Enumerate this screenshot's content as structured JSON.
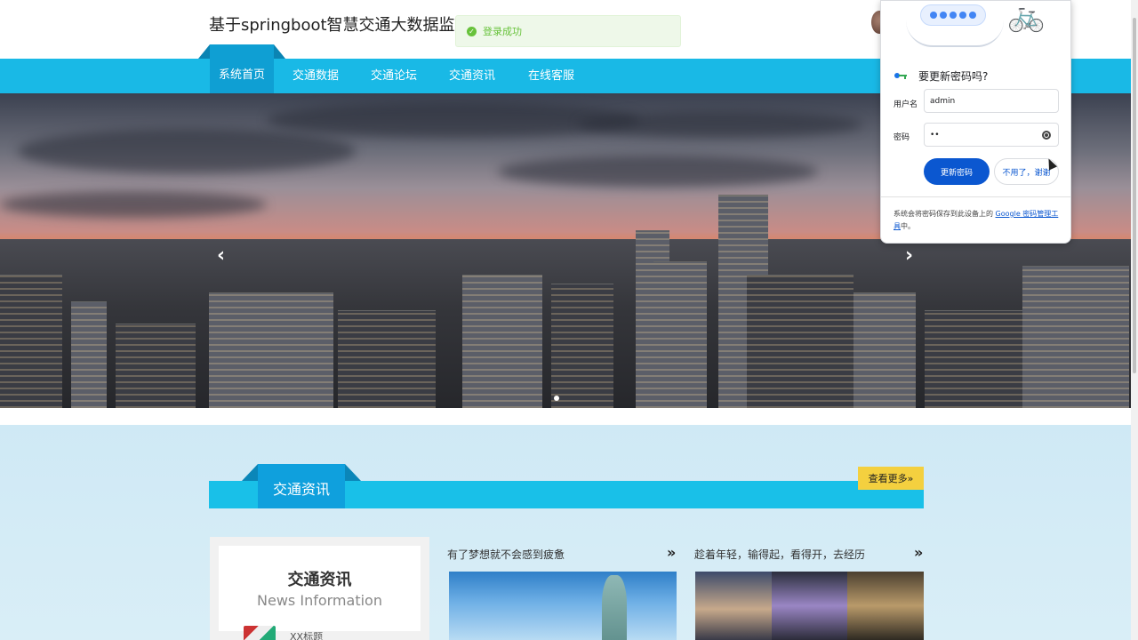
{
  "header": {
    "site_title": "基于springboot智慧交通大数据监控平",
    "toast": "登录成功"
  },
  "nav": {
    "items": [
      "系统首页",
      "交通数据",
      "交通论坛",
      "交通资讯",
      "在线客服"
    ]
  },
  "banner": {
    "prev_icon": "chevron-left-icon",
    "next_icon": "chevron-right-icon"
  },
  "section": {
    "title": "交通资讯",
    "more_label": "查看更多»"
  },
  "news_card": {
    "title": "交通资讯",
    "subtitle": "News Information",
    "item": "XX标题"
  },
  "columns": [
    {
      "title": "有了梦想就不会感到疲惫",
      "arrow": "»"
    },
    {
      "title": "趁着年轻，输得起，看得开，去经历",
      "arrow": "»"
    }
  ],
  "password_popup": {
    "title": "要更新密码吗?",
    "username_label": "用户名",
    "username_value": "admin",
    "password_label": "密码",
    "password_value": "••",
    "update_button": "更新密码",
    "decline_button": "不用了，谢谢",
    "footer_before": "系统会将密码保存到此设备上的 ",
    "footer_link": "Google 密码管理工具",
    "footer_after": "中。"
  }
}
